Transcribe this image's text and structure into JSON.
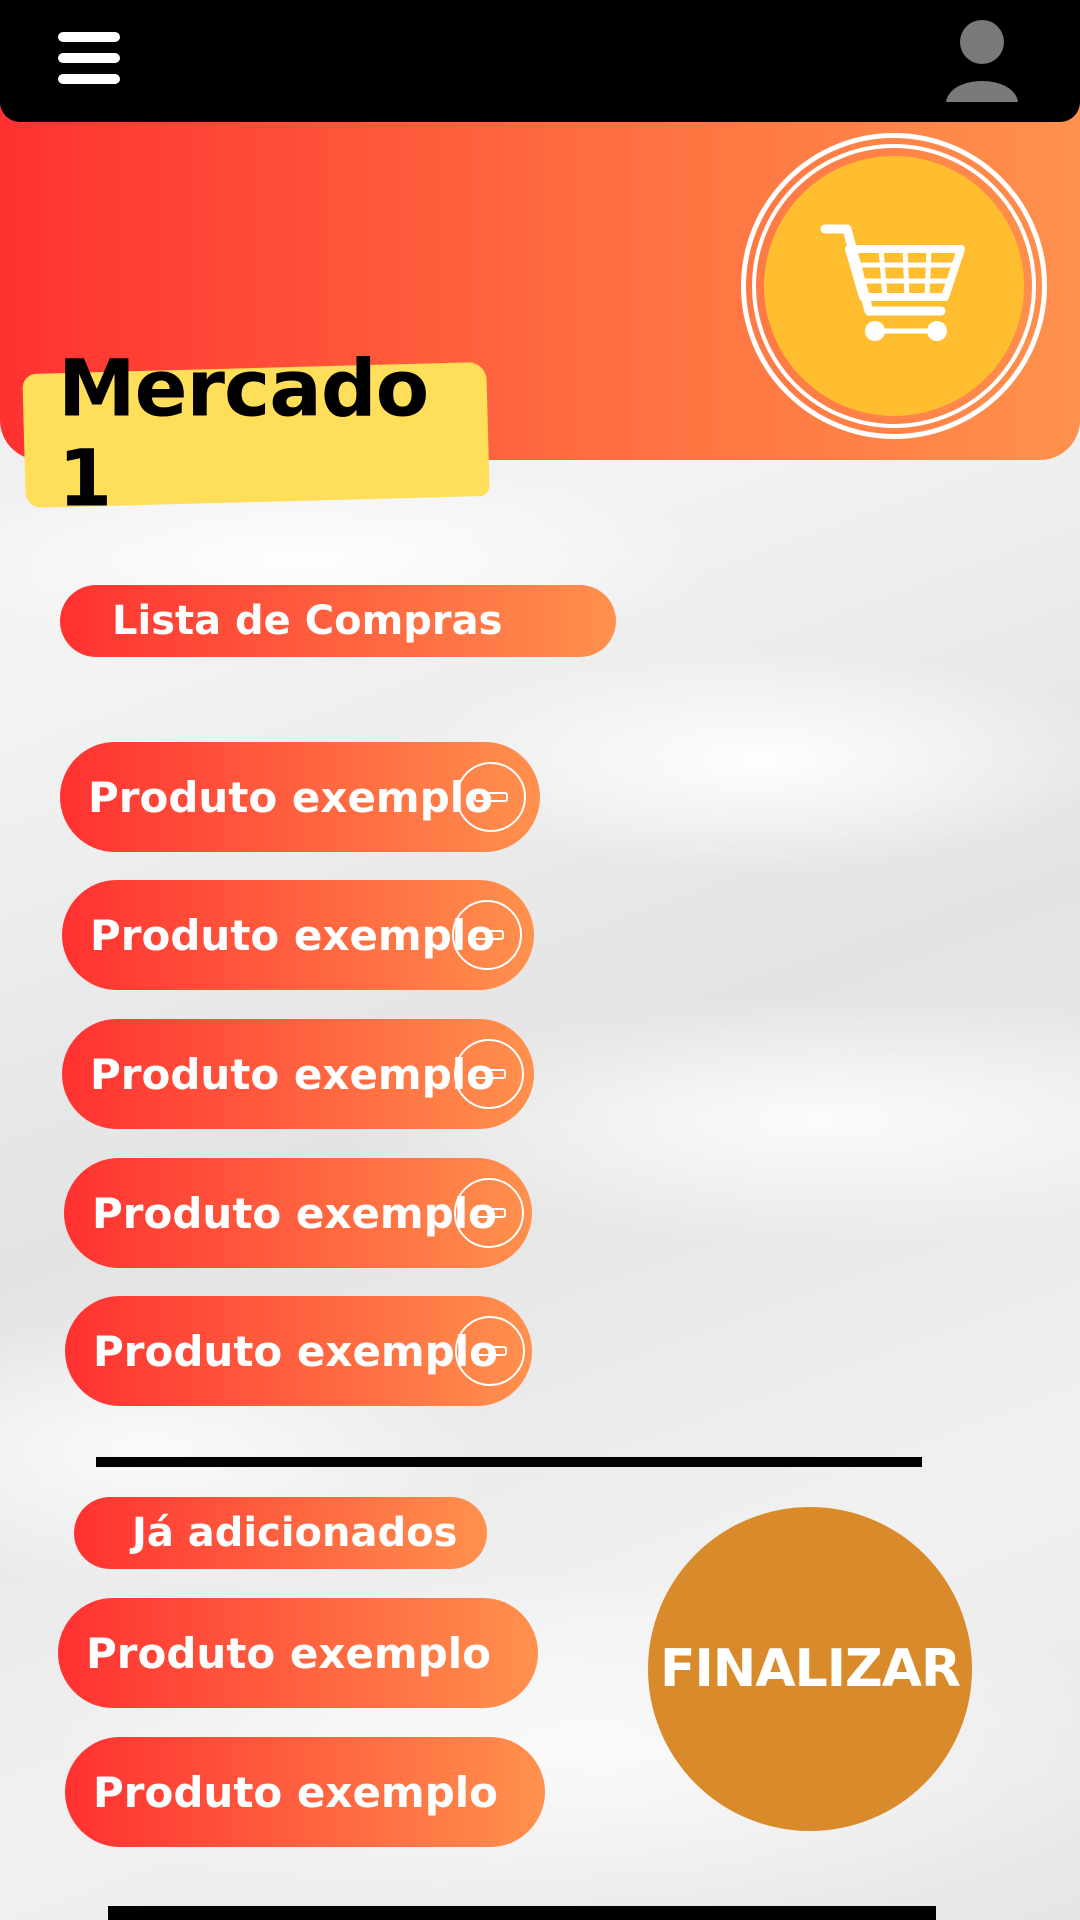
{
  "header": {
    "menu_icon": "hamburger-menu-icon",
    "user_icon": "user-avatar-icon",
    "cart_icon": "shopping-cart-icon"
  },
  "store": {
    "title": "Mercado 1"
  },
  "shopping_list": {
    "label": "Lista de Compras",
    "items": [
      {
        "name": "Produto exemplo",
        "action_icon": "minus-circle-icon"
      },
      {
        "name": "Produto exemplo",
        "action_icon": "minus-circle-icon"
      },
      {
        "name": "Produto exemplo",
        "action_icon": "minus-circle-icon"
      },
      {
        "name": "Produto exemplo",
        "action_icon": "minus-circle-icon"
      },
      {
        "name": "Produto exemplo",
        "action_icon": "minus-circle-icon"
      }
    ]
  },
  "added": {
    "label": "Já adicionados",
    "items": [
      {
        "name": "Produto exemplo"
      },
      {
        "name": "Produto exemplo"
      }
    ]
  },
  "actions": {
    "finalize_label": "FINALIZAR"
  },
  "colors": {
    "gradient_start": "#ff3131",
    "gradient_end": "#ff914d",
    "title_tag": "#ffde59",
    "cart_circle": "#ffbd30",
    "finalize_button": "#d98b2b",
    "topbar": "#000000"
  }
}
